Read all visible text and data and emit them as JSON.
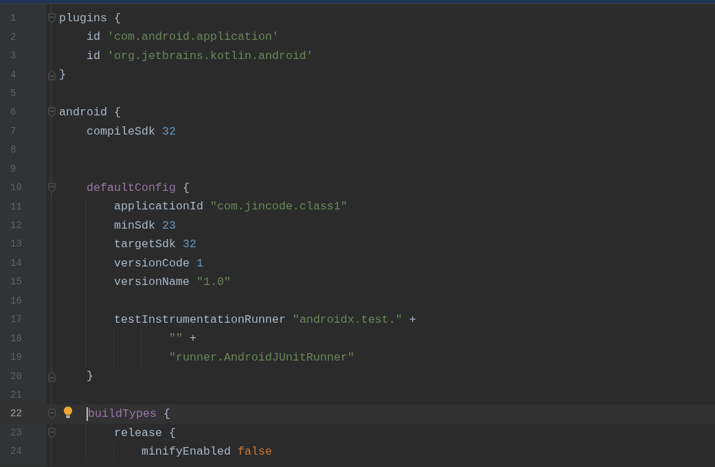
{
  "banner": {
    "kind": "notification"
  },
  "lines": [
    {
      "number": "1",
      "current": false,
      "fold_start": true,
      "fold_end": false,
      "tokens": [
        {
          "text": "plugins {",
          "kind": "plain"
        }
      ],
      "children": [
        {
          "number": "2",
          "current": false,
          "fold_start": false,
          "fold_end": false,
          "tokens": [
            {
              "text": "id",
              "kind": "plain"
            },
            {
              "text": "'com.android.application'",
              "kind": "string"
            }
          ]
        },
        {
          "number": "3",
          "current": false,
          "fold_start": false,
          "fold_end": false,
          "tokens": [
            {
              "text": "id",
              "kind": "plain"
            },
            {
              "text": "'org.jetbrains.kotlin.android'",
              "kind": "string"
            }
          ]
        }
      ]
    },
    {
      "number": "4",
      "current": false,
      "fold_start": false,
      "fold_end": true,
      "tokens": [
        {
          "text": "}",
          "kind": "plain"
        }
      ]
    },
    {
      "number": "5",
      "current": false,
      "fold_start": false,
      "fold_end": false
    },
    {
      "number": "6",
      "current": false,
      "fold_start": true,
      "fold_end": false,
      "tokens": [
        {
          "text": "android {",
          "kind": "plain"
        }
      ],
      "children": [
        {
          "number": "7",
          "current": false,
          "fold_start": false,
          "fold_end": false,
          "tokens": [
            {
              "text": "compileSdk",
              "kind": "plain"
            },
            {
              "text": "32",
              "kind": "number"
            }
          ]
        },
        {
          "number": "8",
          "current": false,
          "fold_start": false,
          "fold_end": false
        },
        {
          "number": "9",
          "current": false,
          "fold_start": false,
          "fold_end": false
        },
        {
          "number": "10",
          "current": false,
          "fold_start": true,
          "fold_end": false,
          "tokens": [
            {
              "text": "defaultConfig",
              "kind": "keyword"
            },
            {
              "text": "{",
              "kind": "plain"
            }
          ],
          "children": [
            {
              "number": "11",
              "current": false,
              "fold_start": false,
              "fold_end": false,
              "tokens": [
                {
                  "text": "applicationId",
                  "kind": "plain"
                },
                {
                  "text": "\"com.jincode.class1\"",
                  "kind": "string"
                }
              ]
            },
            {
              "number": "12",
              "current": false,
              "fold_start": false,
              "fold_end": false,
              "tokens": [
                {
                  "text": "minSdk",
                  "kind": "plain"
                },
                {
                  "text": "23",
                  "kind": "number"
                }
              ]
            },
            {
              "number": "13",
              "current": false,
              "fold_start": false,
              "fold_end": false,
              "tokens": [
                {
                  "text": "targetSdk",
                  "kind": "plain"
                },
                {
                  "text": "32",
                  "kind": "number"
                }
              ]
            },
            {
              "number": "14",
              "current": false,
              "fold_start": false,
              "fold_end": false,
              "tokens": [
                {
                  "text": "versionCode",
                  "kind": "plain"
                },
                {
                  "text": "1",
                  "kind": "number"
                }
              ]
            },
            {
              "number": "15",
              "current": false,
              "fold_start": false,
              "fold_end": false,
              "tokens": [
                {
                  "text": "versionName",
                  "kind": "plain"
                },
                {
                  "text": "\"1.0\"",
                  "kind": "string"
                }
              ]
            },
            {
              "number": "16",
              "current": false,
              "fold_start": false,
              "fold_end": false
            },
            {
              "number": "17",
              "current": false,
              "fold_start": false,
              "fold_end": false,
              "tokens": [
                {
                  "text": "testInstrumentationRunner",
                  "kind": "plain"
                },
                {
                  "text": "\"androidx.test.\"",
                  "kind": "string"
                },
                {
                  "text": "+",
                  "kind": "plain"
                }
              ],
              "children": [
                {
                  "number": "18",
                  "kind": "continuation",
                  "current": false,
                  "fold_start": false,
                  "fold_end": false,
                  "tokens": [
                    {
                      "text": "\"\"",
                      "kind": "string"
                    },
                    {
                      "text": "+",
                      "kind": "plain"
                    }
                  ]
                },
                {
                  "number": "19",
                  "kind": "continuation",
                  "current": false,
                  "fold_start": false,
                  "fold_end": false,
                  "tokens": [
                    {
                      "text": "\"runner.AndroidJUnitRunner\"",
                      "kind": "string"
                    }
                  ]
                }
              ]
            }
          ]
        },
        {
          "number": "20",
          "current": false,
          "fold_start": false,
          "fold_end": true,
          "tokens": [
            {
              "text": "}",
              "kind": "plain"
            }
          ]
        },
        {
          "number": "21",
          "current": false,
          "fold_start": false,
          "fold_end": false
        },
        {
          "number": "22",
          "current": true,
          "fold_start": true,
          "fold_end": false,
          "hint": true,
          "tokens": [
            {
              "text": "buildTypes",
              "kind": "keyword"
            },
            {
              "text": "{",
              "kind": "plain"
            }
          ],
          "children": [
            {
              "number": "23",
              "current": false,
              "fold_start": true,
              "fold_end": false,
              "tokens": [
                {
                  "text": "release {",
                  "kind": "plain"
                }
              ],
              "children": [
                {
                  "number": "24",
                  "current": false,
                  "fold_start": false,
                  "fold_end": false,
                  "tokens": [
                    {
                      "text": "minifyEnabled",
                      "kind": "plain"
                    },
                    {
                      "text": "false",
                      "kind": "literal"
                    }
                  ]
                }
              ]
            }
          ]
        }
      ]
    }
  ]
}
